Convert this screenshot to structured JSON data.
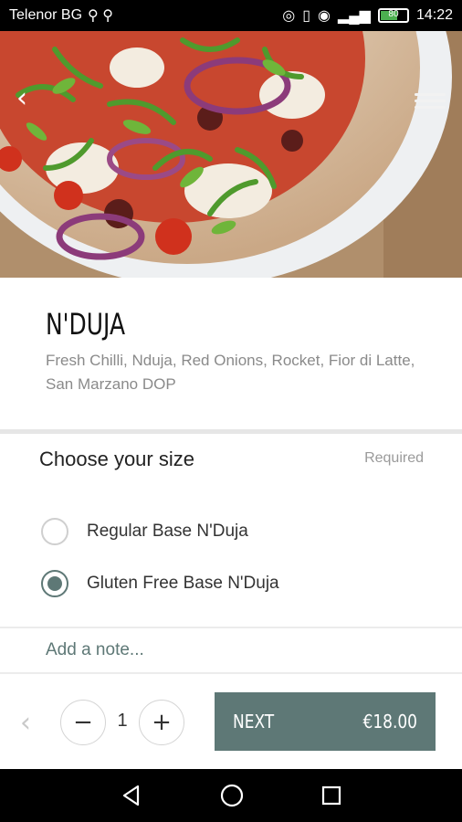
{
  "status_bar": {
    "carrier": "Telenor BG",
    "battery": "80",
    "time": "14:22"
  },
  "product": {
    "title": "N'DUJA",
    "description": "Fresh Chilli, Nduja, Red Onions, Rocket, Fior di Latte, San Marzano DOP"
  },
  "size_section": {
    "heading": "Choose your size",
    "required_label": "Required",
    "options": [
      {
        "label": "Regular Base N'Duja",
        "selected": false
      },
      {
        "label": "Gluten Free Base N'Duja",
        "selected": true
      }
    ]
  },
  "note": {
    "placeholder": "Add a note..."
  },
  "action_bar": {
    "quantity": "1",
    "minus_symbol": "−",
    "plus_symbol": "+",
    "next_label": "NEXT",
    "price": "€18.00"
  },
  "colors": {
    "accent": "#5e7876",
    "text_muted": "#8a8a8a"
  },
  "icons": {
    "back": "chevron-left-icon",
    "menu": "hamburger-menu-icon",
    "nav_back": "triangle-back-icon",
    "nav_home": "circle-home-icon",
    "nav_recents": "square-recents-icon"
  }
}
